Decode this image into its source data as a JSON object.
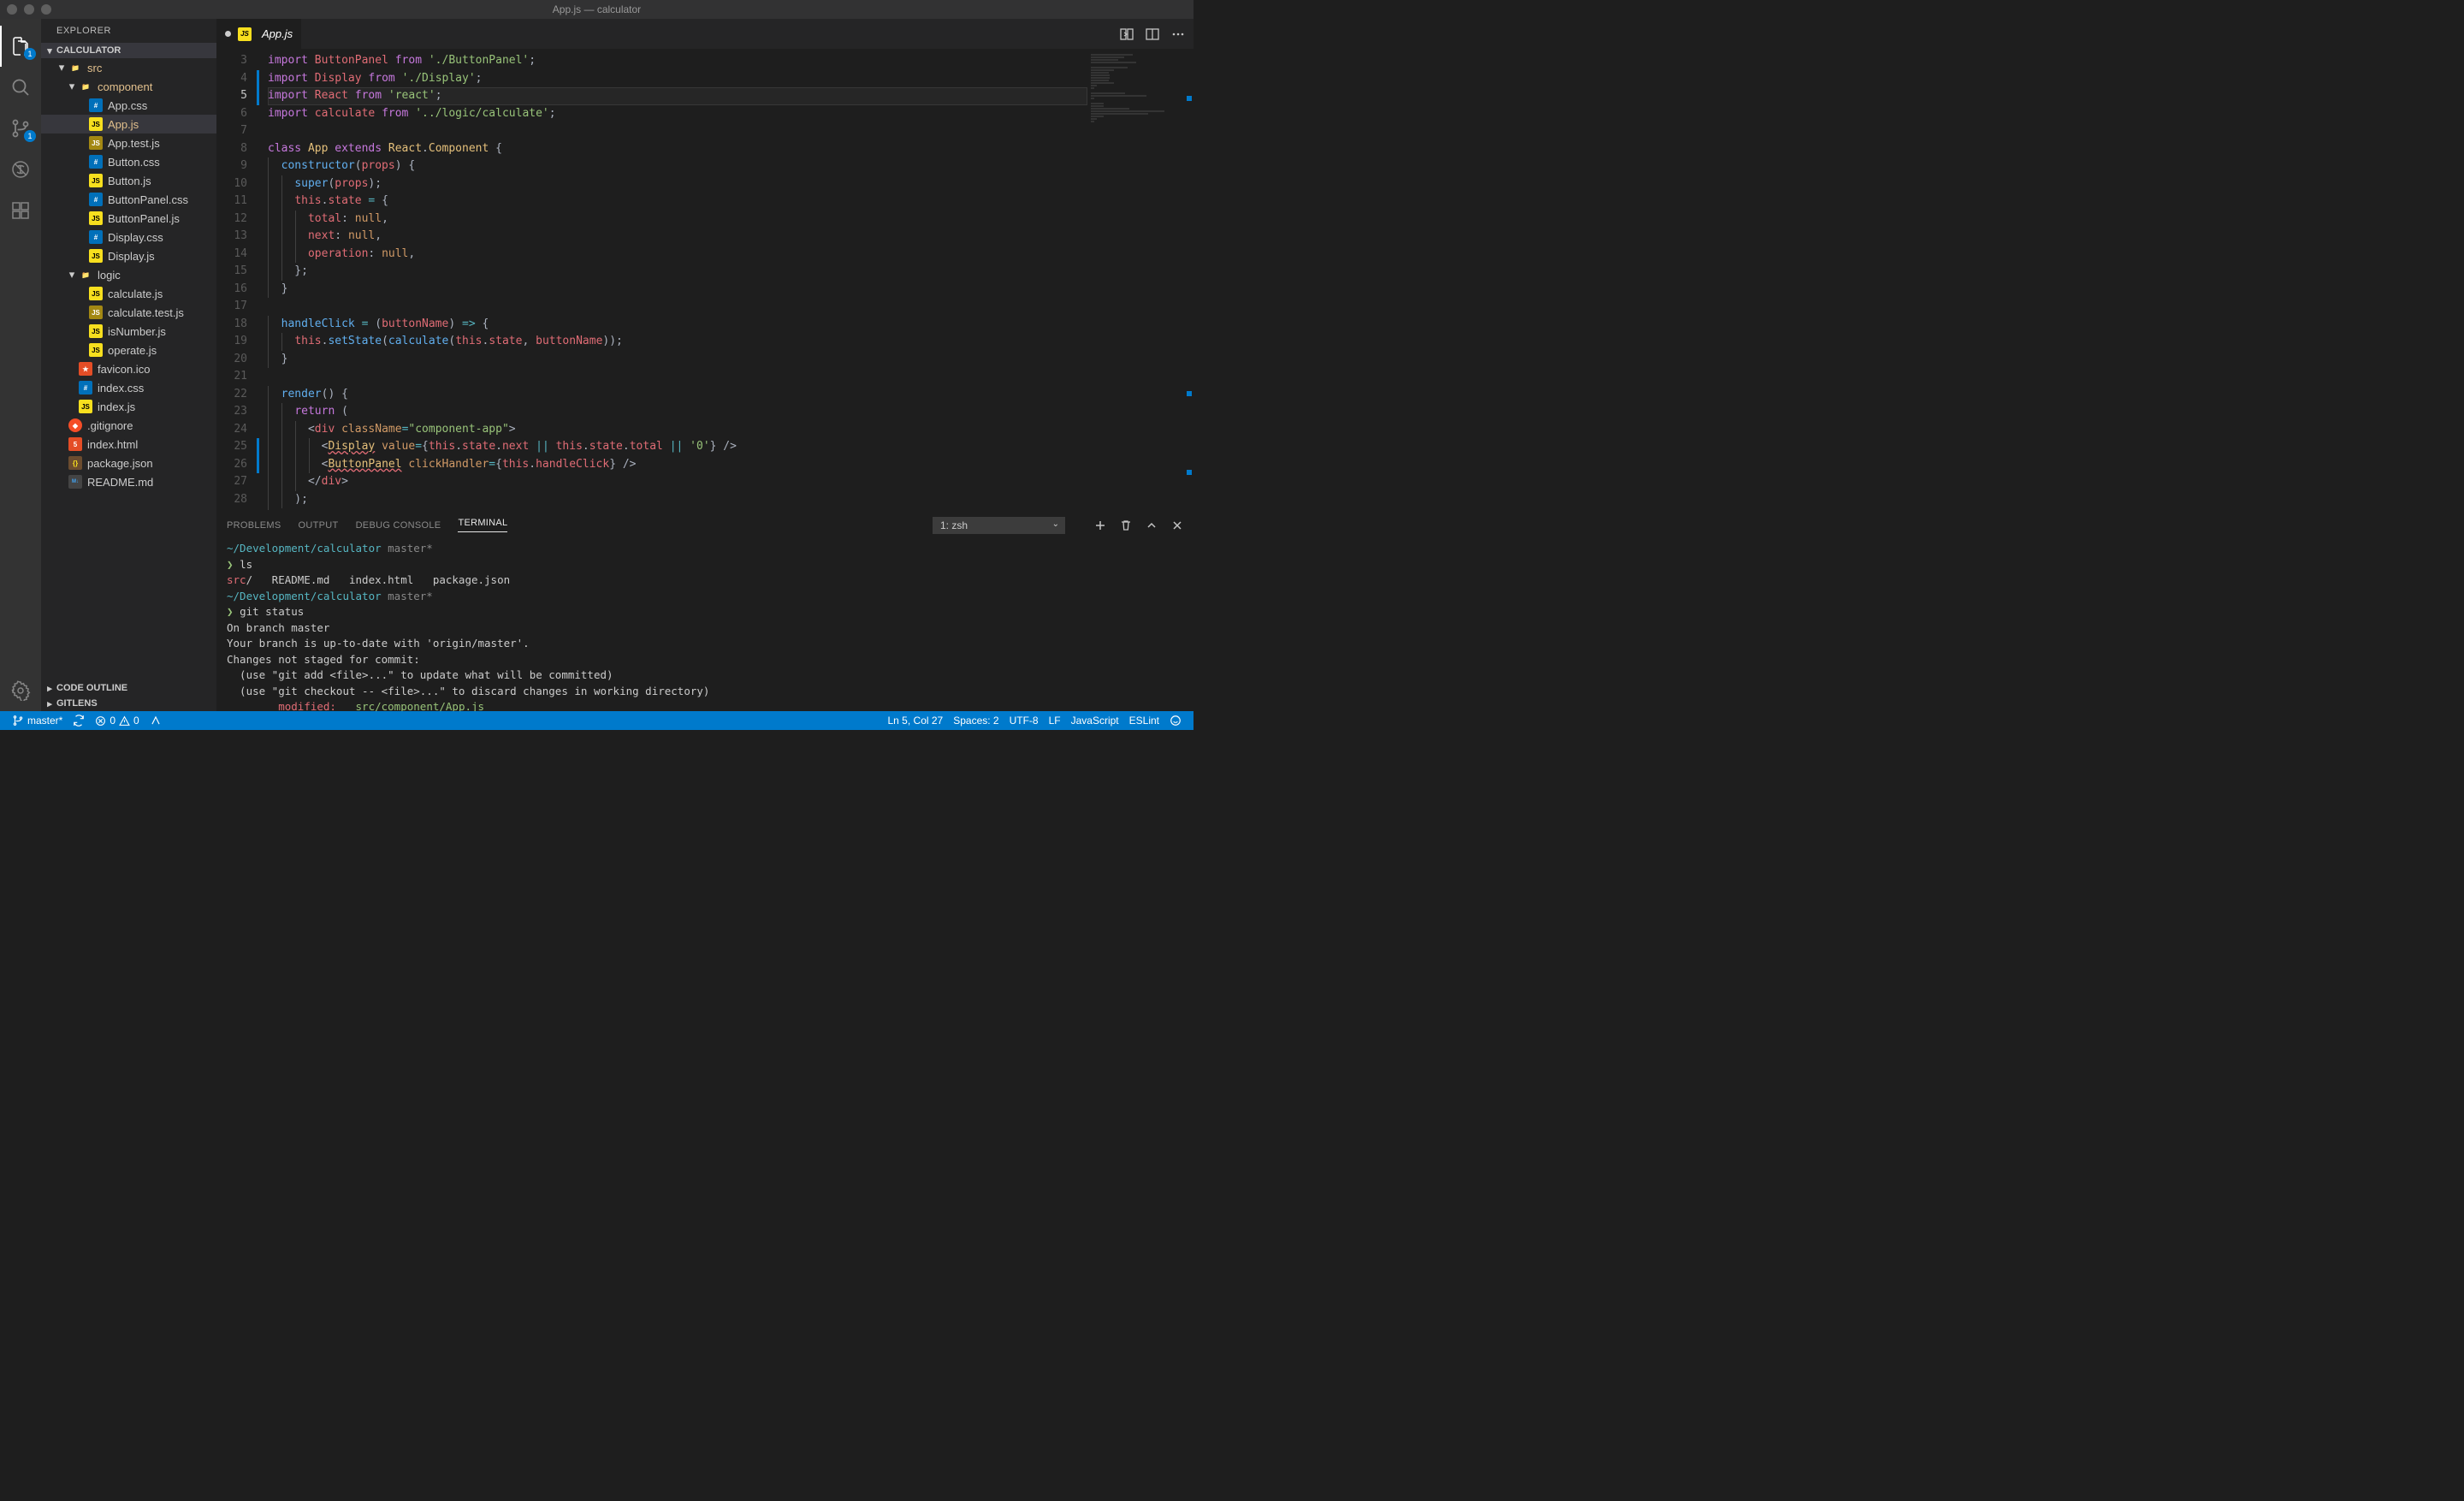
{
  "window": {
    "title": "App.js — calculator"
  },
  "activity": {
    "explorer_badge": "1",
    "scm_badge": "1"
  },
  "sidebar": {
    "title": "EXPLORER",
    "root": "CALCULATOR",
    "tree": [
      {
        "type": "folder",
        "name": "src",
        "depth": 1,
        "open": true,
        "modified": true
      },
      {
        "type": "folder",
        "name": "component",
        "depth": 2,
        "open": true,
        "modified": true
      },
      {
        "type": "file",
        "name": "App.css",
        "depth": 3,
        "icon": "css"
      },
      {
        "type": "file",
        "name": "App.js",
        "depth": 3,
        "icon": "js",
        "selected": true,
        "modified": true
      },
      {
        "type": "file",
        "name": "App.test.js",
        "depth": 3,
        "icon": "test"
      },
      {
        "type": "file",
        "name": "Button.css",
        "depth": 3,
        "icon": "css"
      },
      {
        "type": "file",
        "name": "Button.js",
        "depth": 3,
        "icon": "js"
      },
      {
        "type": "file",
        "name": "ButtonPanel.css",
        "depth": 3,
        "icon": "css"
      },
      {
        "type": "file",
        "name": "ButtonPanel.js",
        "depth": 3,
        "icon": "js"
      },
      {
        "type": "file",
        "name": "Display.css",
        "depth": 3,
        "icon": "css"
      },
      {
        "type": "file",
        "name": "Display.js",
        "depth": 3,
        "icon": "js"
      },
      {
        "type": "folder",
        "name": "logic",
        "depth": 2,
        "open": true
      },
      {
        "type": "file",
        "name": "calculate.js",
        "depth": 3,
        "icon": "js"
      },
      {
        "type": "file",
        "name": "calculate.test.js",
        "depth": 3,
        "icon": "test"
      },
      {
        "type": "file",
        "name": "isNumber.js",
        "depth": 3,
        "icon": "js"
      },
      {
        "type": "file",
        "name": "operate.js",
        "depth": 3,
        "icon": "js"
      },
      {
        "type": "file",
        "name": "favicon.ico",
        "depth": 2,
        "icon": "favicon"
      },
      {
        "type": "file",
        "name": "index.css",
        "depth": 2,
        "icon": "css"
      },
      {
        "type": "file",
        "name": "index.js",
        "depth": 2,
        "icon": "js"
      },
      {
        "type": "file",
        "name": ".gitignore",
        "depth": 1,
        "icon": "git"
      },
      {
        "type": "file",
        "name": "index.html",
        "depth": 1,
        "icon": "html"
      },
      {
        "type": "file",
        "name": "package.json",
        "depth": 1,
        "icon": "json"
      },
      {
        "type": "file",
        "name": "README.md",
        "depth": 1,
        "icon": "md"
      }
    ],
    "sections": [
      "CODE OUTLINE",
      "GITLENS"
    ]
  },
  "tabs": {
    "open": [
      {
        "label": "App.js",
        "icon": "js",
        "dirty": true,
        "active": true
      }
    ]
  },
  "editor": {
    "first_line": 3,
    "current_line": 5,
    "modified_lines_blue": [
      4,
      5,
      25,
      26
    ],
    "lines": [
      [
        [
          "k-import",
          "import"
        ],
        [
          "k-punc",
          " "
        ],
        [
          "k-var",
          "ButtonPanel"
        ],
        [
          "k-punc",
          " "
        ],
        [
          "k-from",
          "from"
        ],
        [
          "k-punc",
          " "
        ],
        [
          "k-str",
          "'./ButtonPanel'"
        ],
        [
          "k-semi",
          ";"
        ]
      ],
      [
        [
          "k-import",
          "import"
        ],
        [
          "k-punc",
          " "
        ],
        [
          "k-var",
          "Display"
        ],
        [
          "k-punc",
          " "
        ],
        [
          "k-from",
          "from"
        ],
        [
          "k-punc",
          " "
        ],
        [
          "k-str",
          "'./Display'"
        ],
        [
          "k-semi",
          ";"
        ]
      ],
      [
        [
          "k-import",
          "import"
        ],
        [
          "k-punc",
          " "
        ],
        [
          "k-var",
          "React"
        ],
        [
          "k-punc",
          " "
        ],
        [
          "k-from",
          "from"
        ],
        [
          "k-punc",
          " "
        ],
        [
          "k-str",
          "'react'"
        ],
        [
          "k-semi",
          ";"
        ]
      ],
      [
        [
          "k-import",
          "import"
        ],
        [
          "k-punc",
          " "
        ],
        [
          "k-var",
          "calculate"
        ],
        [
          "k-punc",
          " "
        ],
        [
          "k-from",
          "from"
        ],
        [
          "k-punc",
          " "
        ],
        [
          "k-str",
          "'../logic/calculate'"
        ],
        [
          "k-semi",
          ";"
        ]
      ],
      [],
      [
        [
          "k-kw",
          "class"
        ],
        [
          "k-punc",
          " "
        ],
        [
          "k-cls",
          "App"
        ],
        [
          "k-punc",
          " "
        ],
        [
          "k-kw",
          "extends"
        ],
        [
          "k-punc",
          " "
        ],
        [
          "k-cls",
          "React"
        ],
        [
          "k-punc",
          "."
        ],
        [
          "k-cls",
          "Component"
        ],
        [
          "k-punc",
          " {"
        ]
      ],
      [
        [
          "k-punc",
          "  "
        ],
        [
          "k-fn",
          "constructor"
        ],
        [
          "k-punc",
          "("
        ],
        [
          "k-var",
          "props"
        ],
        [
          "k-punc",
          ") {"
        ]
      ],
      [
        [
          "k-punc",
          "    "
        ],
        [
          "k-fn",
          "super"
        ],
        [
          "k-punc",
          "("
        ],
        [
          "k-var",
          "props"
        ],
        [
          "k-punc",
          ");"
        ]
      ],
      [
        [
          "k-punc",
          "    "
        ],
        [
          "k-this",
          "this"
        ],
        [
          "k-punc",
          "."
        ],
        [
          "k-prop",
          "state"
        ],
        [
          "k-punc",
          " "
        ],
        [
          "k-op",
          "="
        ],
        [
          "k-punc",
          " {"
        ]
      ],
      [
        [
          "k-punc",
          "      "
        ],
        [
          "k-prop",
          "total"
        ],
        [
          "k-punc",
          ": "
        ],
        [
          "k-null",
          "null"
        ],
        [
          "k-punc",
          ","
        ]
      ],
      [
        [
          "k-punc",
          "      "
        ],
        [
          "k-prop",
          "next"
        ],
        [
          "k-punc",
          ": "
        ],
        [
          "k-null",
          "null"
        ],
        [
          "k-punc",
          ","
        ]
      ],
      [
        [
          "k-punc",
          "      "
        ],
        [
          "k-prop",
          "operation"
        ],
        [
          "k-punc",
          ": "
        ],
        [
          "k-null",
          "null"
        ],
        [
          "k-punc",
          ","
        ]
      ],
      [
        [
          "k-punc",
          "    };"
        ]
      ],
      [
        [
          "k-punc",
          "  }"
        ]
      ],
      [],
      [
        [
          "k-punc",
          "  "
        ],
        [
          "k-fn",
          "handleClick"
        ],
        [
          "k-punc",
          " "
        ],
        [
          "k-op",
          "="
        ],
        [
          "k-punc",
          " ("
        ],
        [
          "k-var",
          "buttonName"
        ],
        [
          "k-punc",
          ") "
        ],
        [
          "k-op",
          "=>"
        ],
        [
          "k-punc",
          " {"
        ]
      ],
      [
        [
          "k-punc",
          "    "
        ],
        [
          "k-this",
          "this"
        ],
        [
          "k-punc",
          "."
        ],
        [
          "k-fn",
          "setState"
        ],
        [
          "k-punc",
          "("
        ],
        [
          "k-fn",
          "calculate"
        ],
        [
          "k-punc",
          "("
        ],
        [
          "k-this",
          "this"
        ],
        [
          "k-punc",
          "."
        ],
        [
          "k-prop",
          "state"
        ],
        [
          "k-punc",
          ", "
        ],
        [
          "k-var",
          "buttonName"
        ],
        [
          "k-punc",
          "));"
        ]
      ],
      [
        [
          "k-punc",
          "  }"
        ]
      ],
      [],
      [
        [
          "k-punc",
          "  "
        ],
        [
          "k-fn",
          "render"
        ],
        [
          "k-punc",
          "() {"
        ]
      ],
      [
        [
          "k-punc",
          "    "
        ],
        [
          "k-kw",
          "return"
        ],
        [
          "k-punc",
          " ("
        ]
      ],
      [
        [
          "k-punc",
          "      <"
        ],
        [
          "k-tag",
          "div"
        ],
        [
          "k-punc",
          " "
        ],
        [
          "k-attr",
          "className"
        ],
        [
          "k-op",
          "="
        ],
        [
          "k-str",
          "\"component-app\""
        ],
        [
          "k-punc",
          ">"
        ]
      ],
      [
        [
          "k-punc",
          "        <"
        ],
        [
          "k-comp k-err",
          "Display"
        ],
        [
          "k-punc",
          " "
        ],
        [
          "k-attr",
          "value"
        ],
        [
          "k-op",
          "="
        ],
        [
          "k-punc",
          "{"
        ],
        [
          "k-this",
          "this"
        ],
        [
          "k-punc",
          "."
        ],
        [
          "k-prop",
          "state"
        ],
        [
          "k-punc",
          "."
        ],
        [
          "k-prop",
          "next"
        ],
        [
          "k-punc",
          " "
        ],
        [
          "k-op",
          "||"
        ],
        [
          "k-punc",
          " "
        ],
        [
          "k-this",
          "this"
        ],
        [
          "k-punc",
          "."
        ],
        [
          "k-prop",
          "state"
        ],
        [
          "k-punc",
          "."
        ],
        [
          "k-prop",
          "total"
        ],
        [
          "k-punc",
          " "
        ],
        [
          "k-op",
          "||"
        ],
        [
          "k-punc",
          " "
        ],
        [
          "k-str",
          "'0'"
        ],
        [
          "k-punc",
          "} />"
        ]
      ],
      [
        [
          "k-punc",
          "        <"
        ],
        [
          "k-comp k-err",
          "ButtonPanel"
        ],
        [
          "k-punc",
          " "
        ],
        [
          "k-attr",
          "clickHandler"
        ],
        [
          "k-op",
          "="
        ],
        [
          "k-punc",
          "{"
        ],
        [
          "k-this",
          "this"
        ],
        [
          "k-punc",
          "."
        ],
        [
          "k-prop",
          "handleClick"
        ],
        [
          "k-punc",
          "} />"
        ]
      ],
      [
        [
          "k-punc",
          "      </"
        ],
        [
          "k-tag",
          "div"
        ],
        [
          "k-punc",
          ">"
        ]
      ],
      [
        [
          "k-punc",
          "    );"
        ]
      ],
      [
        [
          "k-punc",
          "  }"
        ]
      ]
    ]
  },
  "panel": {
    "tabs": [
      "PROBLEMS",
      "OUTPUT",
      "DEBUG CONSOLE",
      "TERMINAL"
    ],
    "active_tab": "TERMINAL",
    "selector": "1: zsh",
    "terminal": [
      {
        "segments": [
          [
            "t-path",
            "~/Development/calculator"
          ],
          [
            "",
            ""
          ],
          [
            "t-branch",
            " master*"
          ]
        ]
      },
      {
        "segments": [
          [
            "t-prompt",
            "❯ "
          ],
          [
            "",
            "ls"
          ]
        ]
      },
      {
        "segments": [
          [
            "t-dir",
            "src"
          ],
          [
            "",
            "/   README.md   index.html   package.json"
          ]
        ]
      },
      {
        "segments": [
          [
            "",
            ""
          ]
        ]
      },
      {
        "segments": [
          [
            "t-path",
            "~/Development/calculator"
          ],
          [
            "t-branch",
            " master*"
          ]
        ]
      },
      {
        "segments": [
          [
            "t-prompt",
            "❯ "
          ],
          [
            "",
            "git status"
          ]
        ]
      },
      {
        "segments": [
          [
            "",
            "On branch master"
          ]
        ]
      },
      {
        "segments": [
          [
            "",
            "Your branch is up-to-date with 'origin/master'."
          ]
        ]
      },
      {
        "segments": [
          [
            "",
            ""
          ]
        ]
      },
      {
        "segments": [
          [
            "",
            "Changes not staged for commit:"
          ]
        ]
      },
      {
        "segments": [
          [
            "",
            "  (use \"git add <file>...\" to update what will be committed)"
          ]
        ]
      },
      {
        "segments": [
          [
            "",
            "  (use \"git checkout -- <file>...\" to discard changes in working directory)"
          ]
        ]
      },
      {
        "segments": [
          [
            "",
            ""
          ]
        ]
      },
      {
        "segments": [
          [
            "",
            "        "
          ],
          [
            "t-mod",
            "modified:   "
          ],
          [
            "t-file",
            "src/component/App.js"
          ]
        ]
      }
    ]
  },
  "status": {
    "branch": "master*",
    "sync": "",
    "errors": "0",
    "warnings": "0",
    "cursor": "Ln 5, Col 27",
    "spaces": "Spaces: 2",
    "encoding": "UTF-8",
    "eol": "LF",
    "language": "JavaScript",
    "linter": "ESLint"
  }
}
